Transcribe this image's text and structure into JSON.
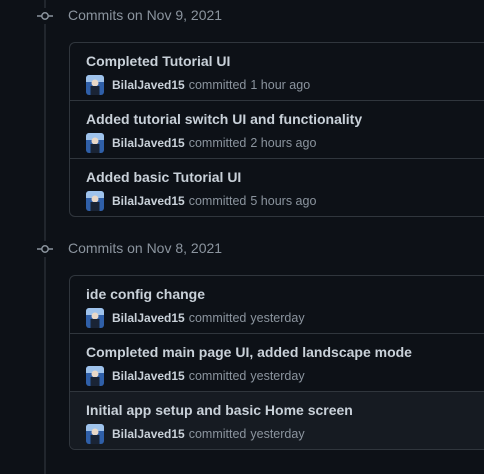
{
  "groups": [
    {
      "title": "Commits on Nov 9, 2021",
      "commits": [
        {
          "message": "Completed Tutorial UI",
          "author": "BilalJaved15",
          "action": "committed",
          "time": "1 hour ago"
        },
        {
          "message": "Added tutorial switch UI and functionality",
          "author": "BilalJaved15",
          "action": "committed",
          "time": "2 hours ago"
        },
        {
          "message": "Added basic Tutorial UI",
          "author": "BilalJaved15",
          "action": "committed",
          "time": "5 hours ago"
        }
      ]
    },
    {
      "title": "Commits on Nov 8, 2021",
      "commits": [
        {
          "message": "ide config change",
          "author": "BilalJaved15",
          "action": "committed",
          "time": "yesterday"
        },
        {
          "message": "Completed main page UI, added landscape mode",
          "author": "BilalJaved15",
          "action": "committed",
          "time": "yesterday"
        },
        {
          "message": "Initial app setup and basic Home screen",
          "author": "BilalJaved15",
          "action": "committed",
          "time": "yesterday"
        }
      ]
    }
  ],
  "icons": {
    "group": "git-commit-icon",
    "avatar": "user-avatar"
  },
  "colors": {
    "background": "#0d1117",
    "border": "#30363d",
    "text_primary": "#c9d1d9",
    "text_muted": "#8b949e",
    "row_hover": "#161b22"
  }
}
